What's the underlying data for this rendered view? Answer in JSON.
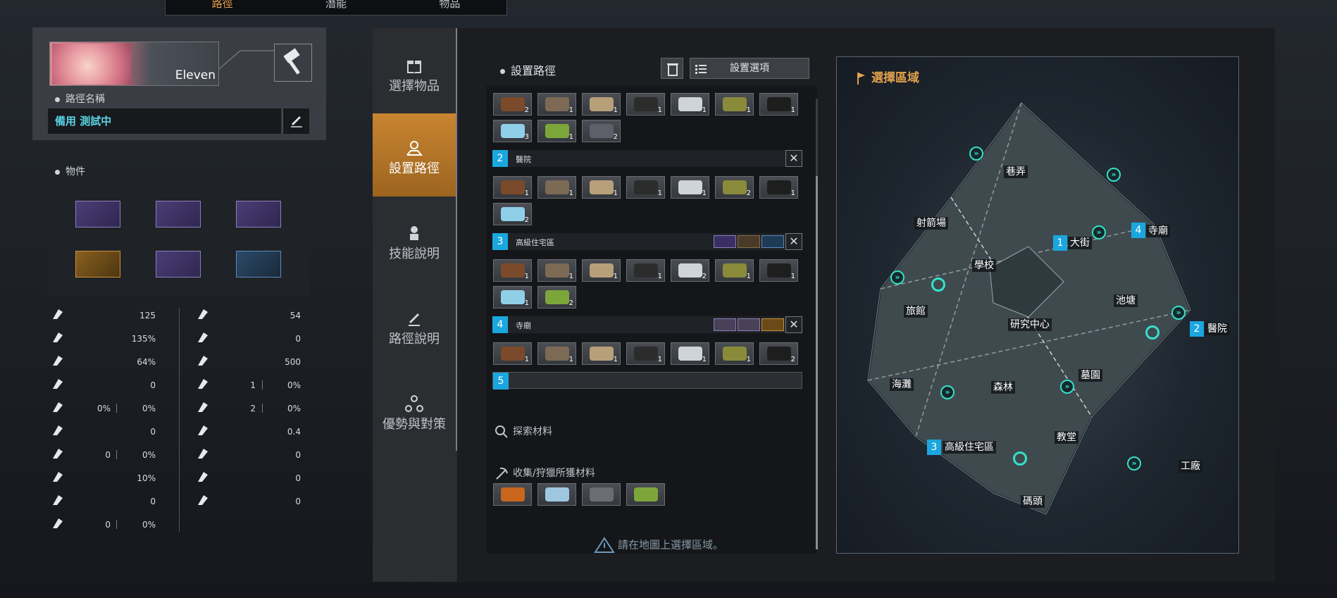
{
  "top_tabs": [
    "路徑",
    "潛能",
    "物品"
  ],
  "profile": {
    "name": "Eleven",
    "route_name_label": "路徑名稱",
    "route_name_value": "備用 測試中"
  },
  "items_label": "物件",
  "stats_left": [
    {
      "icon": "sword-icon",
      "values": [
        "125"
      ]
    },
    {
      "icon": "crit-icon",
      "values": [
        "135%"
      ]
    },
    {
      "icon": "attack-speed-icon",
      "values": [
        "64%"
      ]
    },
    {
      "icon": "gear-slash-icon",
      "values": [
        "0"
      ]
    },
    {
      "icon": "lifesteal-icon",
      "values": [
        "0%",
        "0%"
      ]
    },
    {
      "icon": "sword-plus-icon",
      "values": [
        "0"
      ]
    },
    {
      "icon": "armor-pierce-icon",
      "values": [
        "0",
        "0%"
      ]
    },
    {
      "icon": "hourglass-icon",
      "values": [
        "10%"
      ]
    },
    {
      "icon": "slash-icon",
      "values": [
        "0"
      ]
    },
    {
      "icon": "bleed-icon",
      "values": [
        "0",
        "0%"
      ]
    }
  ],
  "stats_right": [
    {
      "icon": "shield-icon",
      "values": [
        "54"
      ]
    },
    {
      "icon": "house-up-icon",
      "values": [
        "0"
      ]
    },
    {
      "icon": "house-icon",
      "values": [
        "500"
      ]
    },
    {
      "icon": "health-cross-icon",
      "values": [
        "1",
        "0%"
      ]
    },
    {
      "icon": "trend-icon",
      "values": [
        "2",
        "0%"
      ]
    },
    {
      "icon": "dodge-icon",
      "values": [
        "0.4"
      ]
    },
    {
      "icon": "boots-icon",
      "values": [
        "0"
      ]
    },
    {
      "icon": "eye-icon",
      "values": [
        "0"
      ]
    },
    {
      "icon": "dash-icon",
      "values": [
        "0"
      ]
    }
  ],
  "nav": [
    "選擇物品",
    "設置路徑",
    "技能說明",
    "路徑說明",
    "優勢與對策"
  ],
  "center": {
    "title": "設置路徑",
    "options_label": "設置選項",
    "slot_colors": [
      "#7b4a2a",
      "#7d6a55",
      "#b79f7a",
      "#2c2c2c",
      "#cfd4da",
      "#8a8b3a",
      "#1e1e1e",
      "#8fd0e8",
      "#7da63a",
      "#5d6068"
    ],
    "area1_qty": [
      "2",
      "1",
      "1",
      "1",
      "1",
      "1",
      "1",
      "3",
      "1",
      "2"
    ],
    "areas": [
      {
        "num": "2",
        "name": "醫院",
        "qty": [
          "1",
          "1",
          "1",
          "1",
          "1",
          "2",
          "1",
          "2"
        ]
      },
      {
        "num": "3",
        "name": "高級住宅區",
        "qty": [
          "1",
          "1",
          "1",
          "1",
          "2",
          "1",
          "1",
          "1",
          "2"
        ]
      },
      {
        "num": "4",
        "name": "寺廟",
        "qty": [
          "1",
          "1",
          "1",
          "1",
          "1",
          "1",
          "2"
        ]
      }
    ],
    "area5_num": "5",
    "explore_label": "探索材料",
    "collect_label": "收集/狩獵所獲材料",
    "warning": "請在地圖上選擇區域。"
  },
  "map": {
    "title": "選擇區域",
    "locations": [
      "巷弄",
      "射箭場",
      "大街",
      "寺廟",
      "學校",
      "旅館",
      "研究中心",
      "池塘",
      "醫院",
      "海灘",
      "森林",
      "墓園",
      "教堂",
      "高級住宅區",
      "工廠",
      "碼頭"
    ],
    "numbers": [
      "1",
      "2",
      "3",
      "4"
    ]
  }
}
